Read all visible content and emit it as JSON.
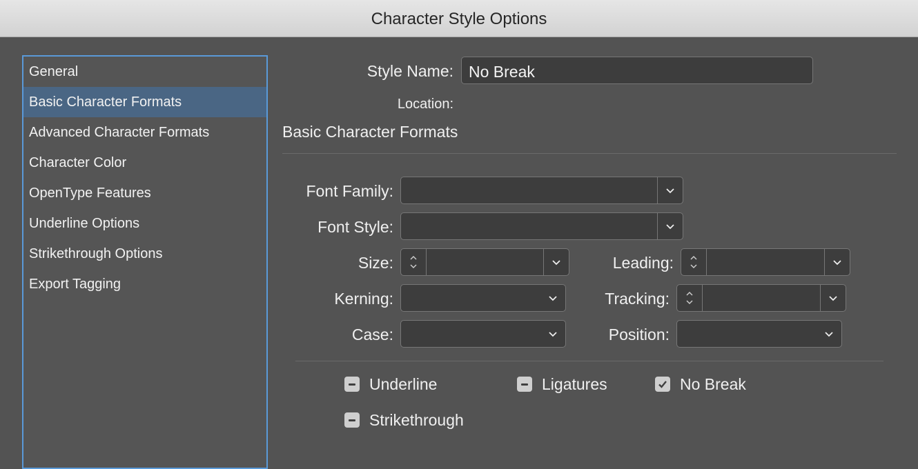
{
  "window": {
    "title": "Character Style Options"
  },
  "sidebar": {
    "items": [
      {
        "label": "General"
      },
      {
        "label": "Basic Character Formats"
      },
      {
        "label": "Advanced Character Formats"
      },
      {
        "label": "Character Color"
      },
      {
        "label": "OpenType Features"
      },
      {
        "label": "Underline Options"
      },
      {
        "label": "Strikethrough Options"
      },
      {
        "label": "Export Tagging"
      }
    ],
    "selected_index": 1
  },
  "style_name": {
    "label": "Style Name:",
    "value": "No Break"
  },
  "location": {
    "label": "Location:"
  },
  "section": {
    "title": "Basic Character Formats"
  },
  "fields": {
    "font_family": {
      "label": "Font Family:",
      "value": ""
    },
    "font_style": {
      "label": "Font Style:",
      "value": ""
    },
    "size": {
      "label": "Size:",
      "value": ""
    },
    "leading": {
      "label": "Leading:",
      "value": ""
    },
    "kerning": {
      "label": "Kerning:",
      "value": ""
    },
    "tracking": {
      "label": "Tracking:",
      "value": ""
    },
    "case": {
      "label": "Case:",
      "value": ""
    },
    "position": {
      "label": "Position:",
      "value": ""
    }
  },
  "checkboxes": {
    "underline": {
      "label": "Underline",
      "state": "mixed"
    },
    "ligatures": {
      "label": "Ligatures",
      "state": "mixed"
    },
    "no_break": {
      "label": "No Break",
      "state": "checked"
    },
    "strikethrough": {
      "label": "Strikethrough",
      "state": "mixed"
    }
  }
}
